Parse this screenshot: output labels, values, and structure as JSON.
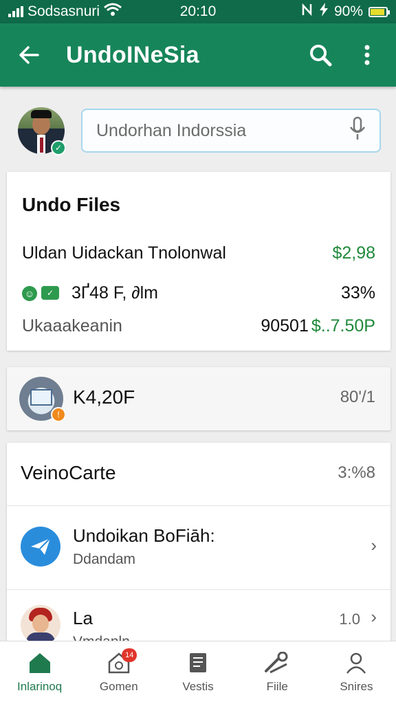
{
  "status_bar": {
    "carrier": "Sodsasnuri",
    "time": "20:10",
    "battery_percent": "90%",
    "battery_level": 0.9,
    "battery_color": "#e5dc2c"
  },
  "app_bar": {
    "title": "UndoINeSia",
    "color": "#17855a"
  },
  "search": {
    "value": "Undorhan Indorssia"
  },
  "card_files": {
    "title": "Undo Files",
    "row1_label": "Uldan Uidackan Tnolonwal",
    "row1_value": "$2,98",
    "row2_label": "3Ґ48 F, ∂lm",
    "row2_value": "33%",
    "row3_label": "Ukaaakeanin",
    "row3_value_prefix": "90501",
    "row3_value_amount": "$..7.50P"
  },
  "card_k": {
    "label": "K4,20F",
    "value": "80'/1"
  },
  "card_list": {
    "header_label": "VeinoCarte",
    "header_value": "3:%8",
    "items": [
      {
        "title": "Undoikan BoFiāh:",
        "subtitle": "Ddandam"
      },
      {
        "title": "La",
        "subtitle": "Vmdanln",
        "value": "1.0"
      }
    ]
  },
  "bottom_nav": {
    "items": [
      {
        "label": "Inlarinoq",
        "icon": "home-icon"
      },
      {
        "label": "Gomen",
        "icon": "house-badge-icon",
        "badge": "14"
      },
      {
        "label": "Vestis",
        "icon": "document-icon"
      },
      {
        "label": "Fiile",
        "icon": "tools-icon"
      },
      {
        "label": "Snires",
        "icon": "profile-icon"
      }
    ]
  }
}
